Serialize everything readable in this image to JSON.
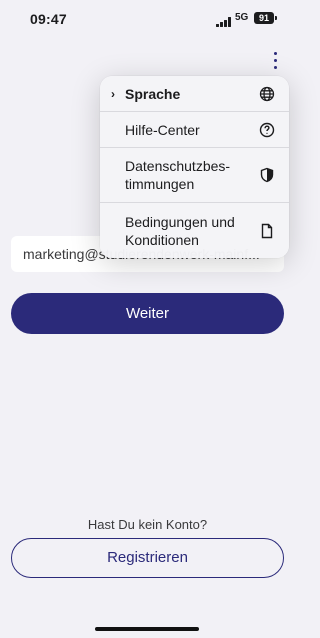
{
  "status_bar": {
    "time": "09:47",
    "network": "5G",
    "battery": "91"
  },
  "menu": {
    "items": [
      {
        "label": "Sprache",
        "icon": "globe-icon",
        "selected": true
      },
      {
        "label": "Hilfe-Center",
        "icon": "question-circle-icon",
        "selected": false
      },
      {
        "label": "Datenschutzbes-\ntimmungen",
        "icon": "shield-icon",
        "selected": false
      },
      {
        "label": "Bedingungen und\nKonditionen",
        "icon": "document-icon",
        "selected": false
      }
    ],
    "check_mark": "›"
  },
  "login": {
    "email_value": "marketing@studierendenwerk-mainf...",
    "continue_label": "Weiter",
    "no_account_text": "Hast Du kein Konto?",
    "register_label": "Registrieren"
  },
  "colors": {
    "accent": "#2b2a7a",
    "background": "#f2f1f6"
  }
}
